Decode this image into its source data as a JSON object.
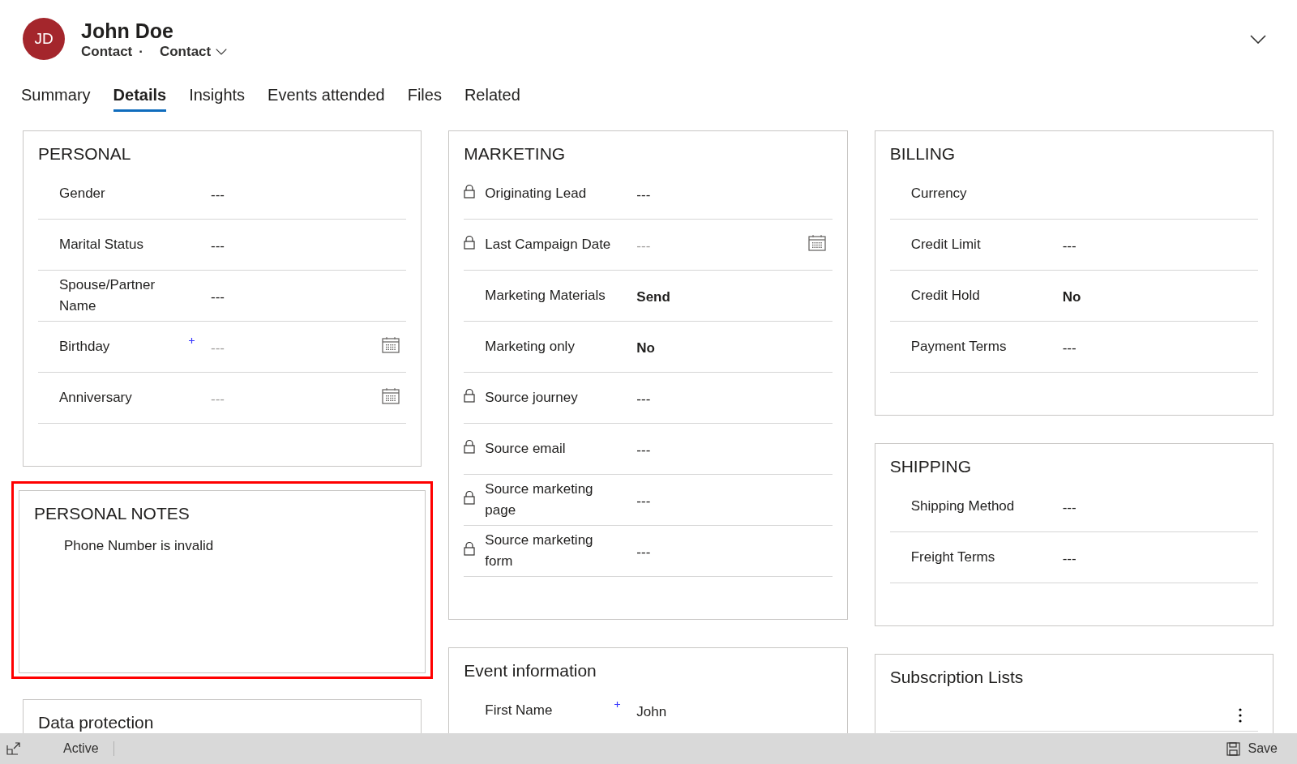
{
  "header": {
    "initials": "JD",
    "name": "John Doe",
    "entity": "Contact",
    "separator": "·",
    "form": "Contact"
  },
  "tabs": [
    {
      "label": "Summary",
      "selected": false
    },
    {
      "label": "Details",
      "selected": true
    },
    {
      "label": "Insights",
      "selected": false
    },
    {
      "label": "Events attended",
      "selected": false
    },
    {
      "label": "Files",
      "selected": false
    },
    {
      "label": "Related",
      "selected": false
    }
  ],
  "columns": [
    {
      "sections": [
        {
          "title": "PERSONAL",
          "highlighted": false,
          "fields": [
            {
              "label": "Gender",
              "value": "---",
              "kind": "text",
              "locked": false,
              "required": false
            },
            {
              "label": "Marital Status",
              "value": "---",
              "kind": "text",
              "locked": false,
              "required": false
            },
            {
              "label": "Spouse/Partner Name",
              "value": "---",
              "kind": "text",
              "locked": false,
              "required": false
            },
            {
              "label": "Birthday",
              "placeholder": "---",
              "kind": "date",
              "locked": false,
              "required": true
            },
            {
              "label": "Anniversary",
              "placeholder": "---",
              "kind": "date",
              "locked": false,
              "required": false
            }
          ]
        },
        {
          "title": "PERSONAL NOTES",
          "highlighted": true,
          "note": "Phone Number is invalid"
        },
        {
          "title": "Data protection",
          "highlighted": false
        }
      ]
    },
    {
      "sections": [
        {
          "title": "MARKETING",
          "highlighted": false,
          "fields": [
            {
              "label": "Originating Lead",
              "value": "---",
              "kind": "text",
              "locked": true,
              "required": false
            },
            {
              "label": "Last Campaign Date",
              "placeholder": "---",
              "kind": "date",
              "locked": true,
              "required": false
            },
            {
              "label": "Marketing Materials",
              "value": "Send",
              "kind": "option",
              "locked": false,
              "required": false
            },
            {
              "label": "Marketing only",
              "value": "No",
              "kind": "option",
              "locked": false,
              "required": false
            },
            {
              "label": "Source journey",
              "value": "---",
              "kind": "text",
              "locked": true,
              "required": false
            },
            {
              "label": "Source email",
              "value": "---",
              "kind": "text",
              "locked": true,
              "required": false
            },
            {
              "label": "Source marketing page",
              "value": "---",
              "kind": "text",
              "locked": true,
              "required": false
            },
            {
              "label": "Source marketing form",
              "value": "---",
              "kind": "text",
              "locked": true,
              "required": false
            }
          ]
        },
        {
          "title": "Event information",
          "highlighted": false,
          "fields": [
            {
              "label": "First Name",
              "value": "John",
              "kind": "text",
              "locked": false,
              "required": true
            }
          ]
        }
      ]
    },
    {
      "sections": [
        {
          "title": "BILLING",
          "highlighted": false,
          "fields": [
            {
              "label": "Currency",
              "kind": "text",
              "locked": false,
              "required": false
            },
            {
              "label": "Credit Limit",
              "value": "---",
              "kind": "text",
              "locked": false,
              "required": false
            },
            {
              "label": "Credit Hold",
              "value": "No",
              "kind": "option",
              "locked": false,
              "required": false
            },
            {
              "label": "Payment Terms",
              "value": "---",
              "kind": "text",
              "locked": false,
              "required": false
            }
          ]
        },
        {
          "title": "SHIPPING",
          "highlighted": false,
          "fields": [
            {
              "label": "Shipping Method",
              "value": "---",
              "kind": "text",
              "locked": false,
              "required": false
            },
            {
              "label": "Freight Terms",
              "value": "---",
              "kind": "text",
              "locked": false,
              "required": false
            }
          ]
        },
        {
          "title": "Subscription Lists",
          "highlighted": false,
          "more_menu": true
        }
      ]
    }
  ],
  "status_bar": {
    "status": "Active",
    "save": "Save"
  }
}
